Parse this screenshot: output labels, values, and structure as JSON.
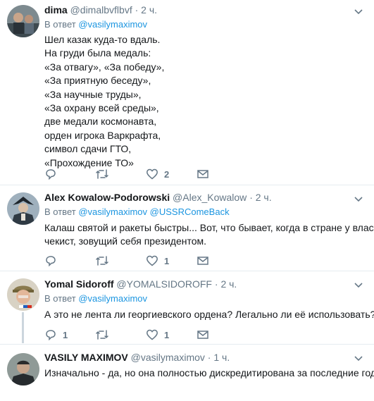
{
  "colors": {
    "link": "#1b95e0",
    "secondary": "#657786",
    "separator": "#e6ecf0",
    "thread_line": "#ccd6dd"
  },
  "tweets": [
    {
      "name": "dima",
      "handle": "@dimalbvflbvf",
      "dot": "·",
      "time": "2 ч.",
      "reply_prefix": "В ответ",
      "reply_mentions": [
        "@vasilymaximov"
      ],
      "text_lines": [
        "Шел казак куда-то вдаль.",
        "На груди была медаль:",
        "«За отвагу», «За победу»,",
        "«За приятную беседу»,",
        "«За научные труды»,",
        "«За охрану всей среды»,",
        "две медали космонавта,",
        "орден игрока Варкрафта,",
        "символ сдачи ГТО,",
        "«Прохождение ТО»"
      ],
      "actions": {
        "replies": "",
        "retweets": "",
        "likes": "2"
      }
    },
    {
      "name": "Alex Kowalow-Podorowski",
      "handle": "@Alex_Kowalow",
      "dot": "·",
      "time": "2 ч.",
      "reply_prefix": "В ответ",
      "reply_mentions": [
        "@vasilymaximov",
        "@USSRComeBack"
      ],
      "text_lines": [
        "Калаш святой и ракеты быстры... Вот, что бывает, когда в стране у власти",
        "чекист, зовущий себя президентом."
      ],
      "actions": {
        "replies": "",
        "retweets": "",
        "likes": "1"
      }
    },
    {
      "name": "Yomal Sidoroff",
      "handle": "@YOMALSIDOROFF",
      "dot": "·",
      "time": "2 ч.",
      "reply_prefix": "В ответ",
      "reply_mentions": [
        "@vasilymaximov"
      ],
      "text_lines": [
        "А это не лента ли георгиевского ордена? Легально ли её использовать?"
      ],
      "actions": {
        "replies": "1",
        "retweets": "",
        "likes": "1"
      }
    },
    {
      "name": "VASILY MAXIMOV",
      "handle": "@vasilymaximov",
      "dot": "·",
      "time": "1 ч.",
      "text_lines": [
        "Изначально - да, но она полностью дискредитирована за последние годы."
      ]
    }
  ]
}
